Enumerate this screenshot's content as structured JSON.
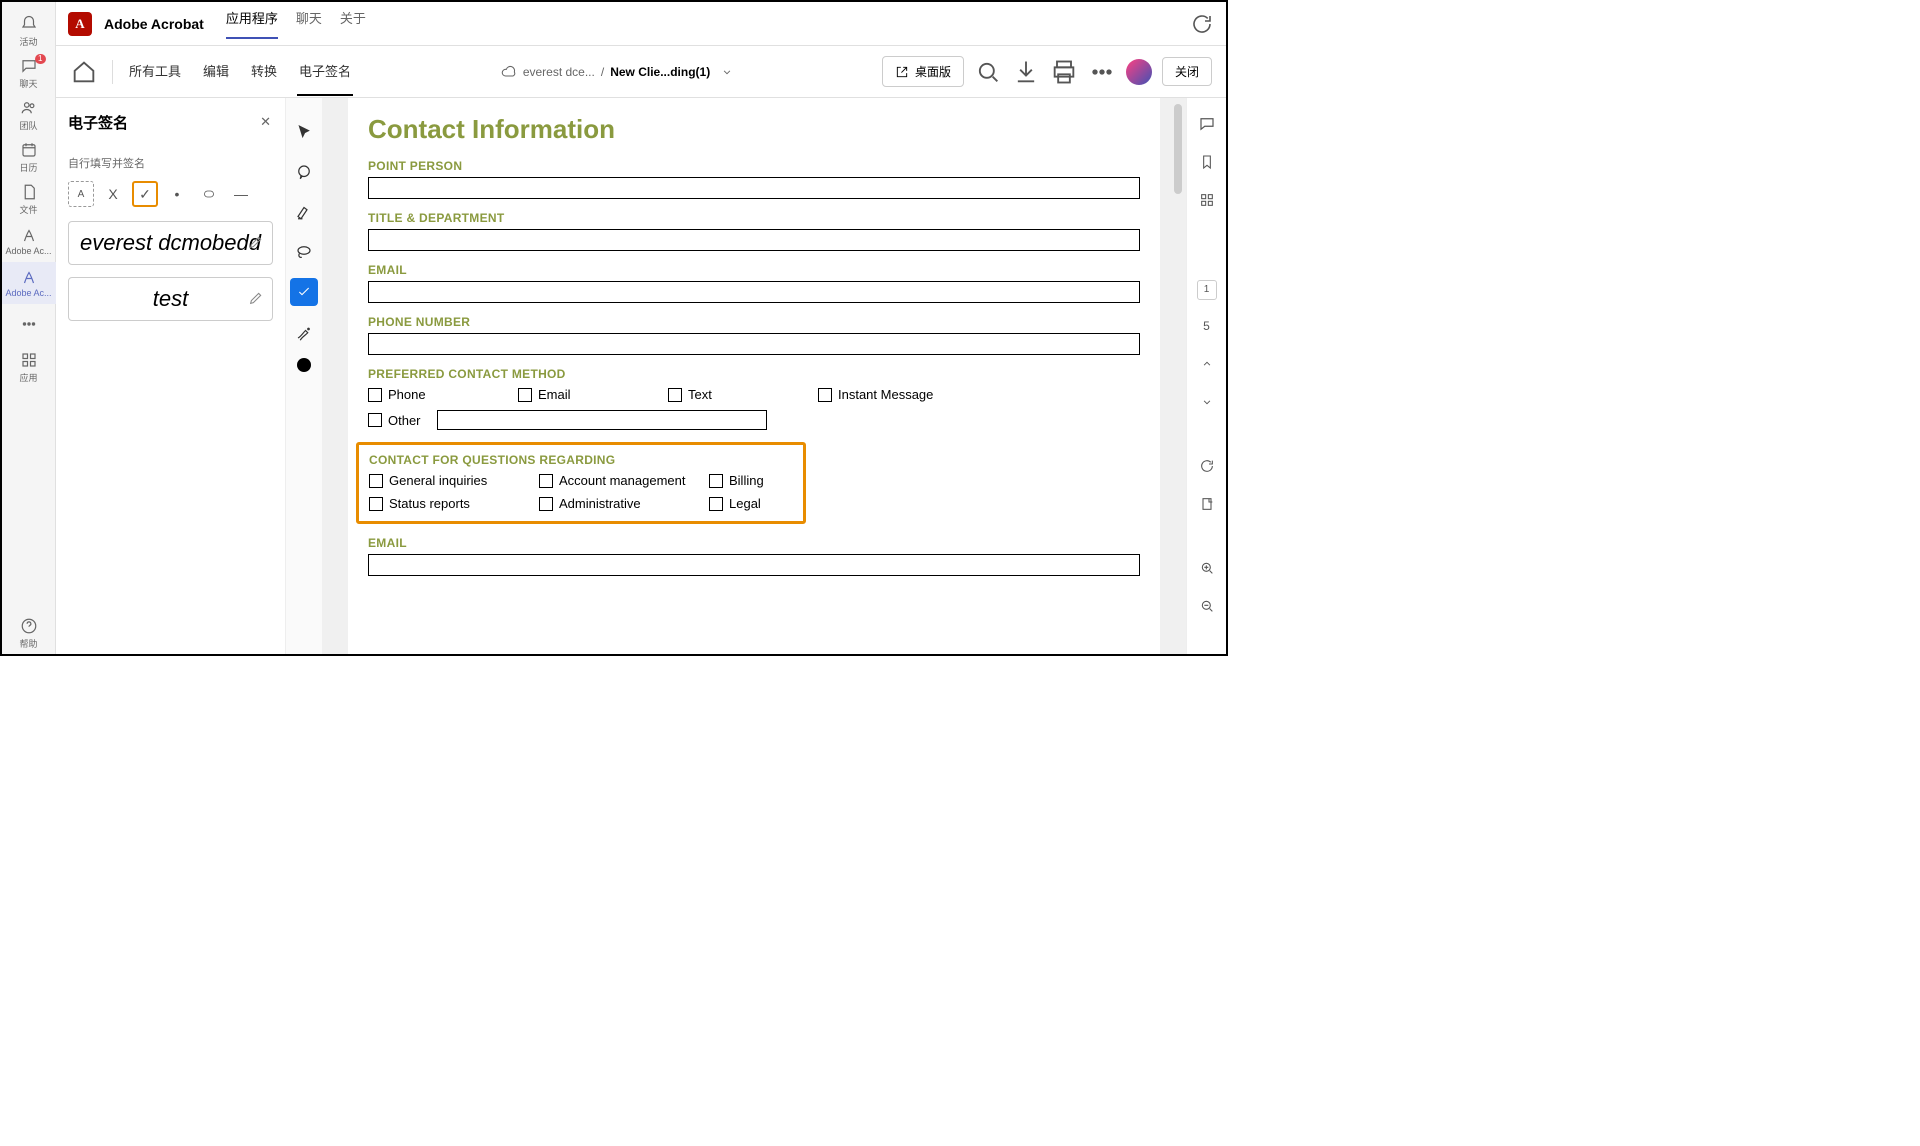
{
  "leftRail": {
    "activity": "活动",
    "chat": "聊天",
    "chatBadge": "1",
    "calendar": "日历",
    "teams": "团队",
    "files": "文件",
    "acrobat1": "Adobe Ac...",
    "acrobat2": "Adobe Ac...",
    "more": "",
    "apps": "应用",
    "help": "帮助"
  },
  "topBar": {
    "appTitle": "Adobe Acrobat",
    "tabs": {
      "app": "应用程序",
      "chat": "聊天",
      "about": "关于"
    }
  },
  "secBar": {
    "tabs": {
      "all": "所有工具",
      "edit": "编辑",
      "convert": "转换",
      "sign": "电子签名"
    },
    "cloudName": "everest dce...",
    "docName": "New Clie...ding(1)",
    "desktop": "桌面版",
    "close": "关闭"
  },
  "signPanel": {
    "title": "电子签名",
    "subtitle": "自行填写并签名",
    "sigFull": "everest dcmobedd",
    "sigShort": "test"
  },
  "doc": {
    "heading": "Contact Information",
    "labels": {
      "point": "POINT PERSON",
      "title": "TITLE & DEPARTMENT",
      "email": "EMAIL",
      "phone": "PHONE NUMBER",
      "preferred": "PREFERRED CONTACT METHOD",
      "contactFor": "CONTACT FOR QUESTIONS REGARDING",
      "email2": "EMAIL"
    },
    "preferred": {
      "phone": "Phone",
      "email": "Email",
      "text": "Text",
      "im": "Instant Message",
      "other": "Other"
    },
    "contactFor": {
      "gi": "General inquiries",
      "am": "Account management",
      "bill": "Billing",
      "sr": "Status reports",
      "adm": "Administrative",
      "legal": "Legal"
    }
  },
  "rightRail": {
    "page": "1",
    "total": "5"
  }
}
